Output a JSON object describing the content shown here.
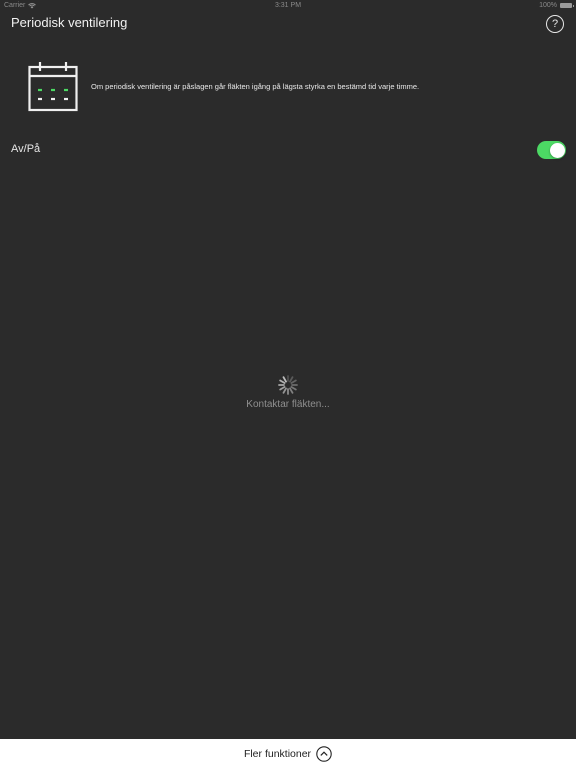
{
  "status_bar": {
    "carrier": "Carrier",
    "time": "3:31 PM",
    "battery": "100%"
  },
  "header": {
    "title": "Periodisk ventilering",
    "help_label": "?"
  },
  "info": {
    "description": "Om periodisk ventilering är påslagen går fläkten igång på lägsta styrka en bestämd tid varje timme.",
    "icon": "calendar-icon"
  },
  "toggle": {
    "label": "Av/På",
    "state": "on",
    "on_color": "#4cd964"
  },
  "loading": {
    "text": "Kontaktar fläkten..."
  },
  "footer": {
    "label": "Fler funktioner",
    "icon": "chevron-up-icon"
  },
  "colors": {
    "background": "#2b2b2b",
    "footer_background": "#ffffff",
    "accent_green": "#4cd964"
  }
}
